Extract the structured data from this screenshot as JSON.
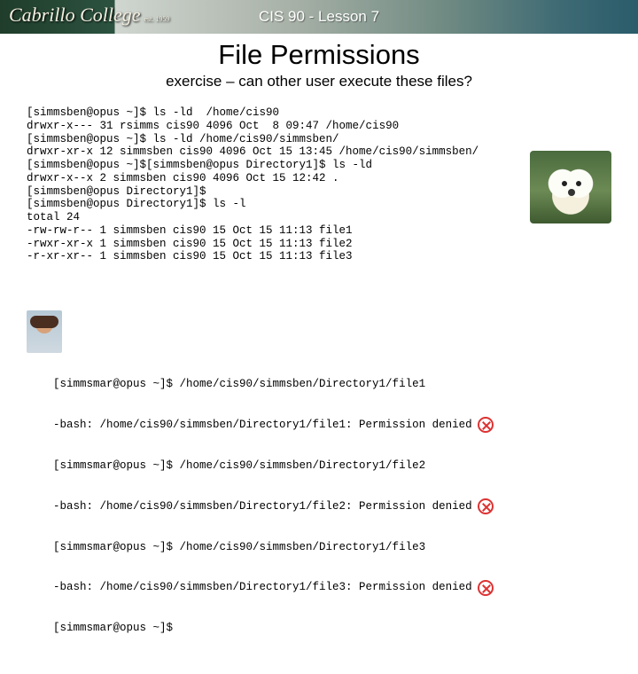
{
  "banner": {
    "logo_text": "Cabrillo College",
    "logo_est": "est. 1959",
    "title": "CIS 90 - Lesson 7"
  },
  "headline": "File Permissions",
  "subhead": "exercise – can other user execute these files?",
  "terminal1": "[simmsben@opus ~]$ ls -ld  /home/cis90\ndrwxr-x--- 31 rsimms cis90 4096 Oct  8 09:47 /home/cis90\n[simmsben@opus ~]$ ls -ld /home/cis90/simmsben/\ndrwxr-xr-x 12 simmsben cis90 4096 Oct 15 13:45 /home/cis90/simmsben/\n[simmsben@opus ~]$[simmsben@opus Directory1]$ ls -ld\ndrwxr-x--x 2 simmsben cis90 4096 Oct 15 12:42 .\n[simmsben@opus Directory1]$\n[simmsben@opus Directory1]$ ls -l\ntotal 24\n-rw-rw-r-- 1 simmsben cis90 15 Oct 15 11:13 file1\n-rwxr-xr-x 1 simmsben cis90 15 Oct 15 11:13 file2\n-r-xr-xr-- 1 simmsben cis90 15 Oct 15 11:13 file3",
  "terminal2": {
    "l1": "[simmsmar@opus ~]$ /home/cis90/simmsben/Directory1/file1",
    "l2": "-bash: /home/cis90/simmsben/Directory1/file1: Permission denied",
    "l3": "[simmsmar@opus ~]$ /home/cis90/simmsben/Directory1/file2",
    "l4": "-bash: /home/cis90/simmsben/Directory1/file2: Permission denied",
    "l5": "[simmsmar@opus ~]$ /home/cis90/simmsben/Directory1/file3",
    "l6": "-bash: /home/cis90/simmsben/Directory1/file3: Permission denied",
    "l7": "[simmsmar@opus ~]$"
  },
  "icons": {
    "denied": "denied-icon"
  }
}
